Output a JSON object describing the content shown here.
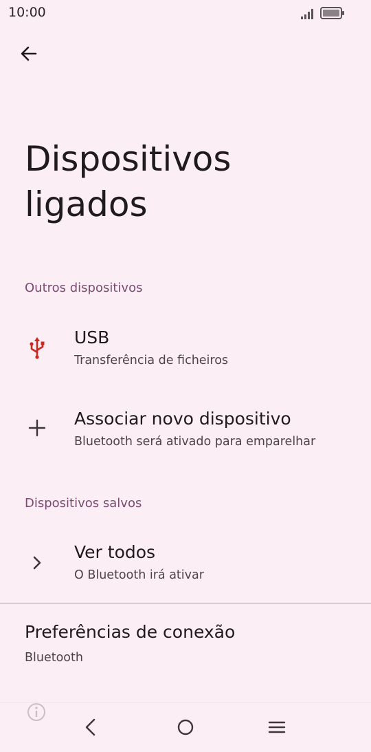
{
  "status": {
    "time": "10:00"
  },
  "header": {
    "title": "Dispositivos ligados"
  },
  "sections": {
    "other_devices": "Outros dispositivos",
    "saved_devices": "Dispositivos salvos"
  },
  "items": {
    "usb": {
      "title": "USB",
      "subtitle": "Transferência de ficheiros",
      "icon": "usb-icon"
    },
    "pair": {
      "title": "Associar novo dispositivo",
      "subtitle": "Bluetooth será ativado para emparelhar",
      "icon": "plus-icon"
    },
    "see_all": {
      "title": "Ver todos",
      "subtitle": "O Bluetooth irá ativar",
      "icon": "chevron-right-icon"
    }
  },
  "preferences": {
    "title": "Preferências de conexão",
    "subtitle": "Bluetooth"
  },
  "colors": {
    "background": "#fbeef4",
    "accent": "#7b4a72",
    "usb_icon": "#c8281e"
  }
}
